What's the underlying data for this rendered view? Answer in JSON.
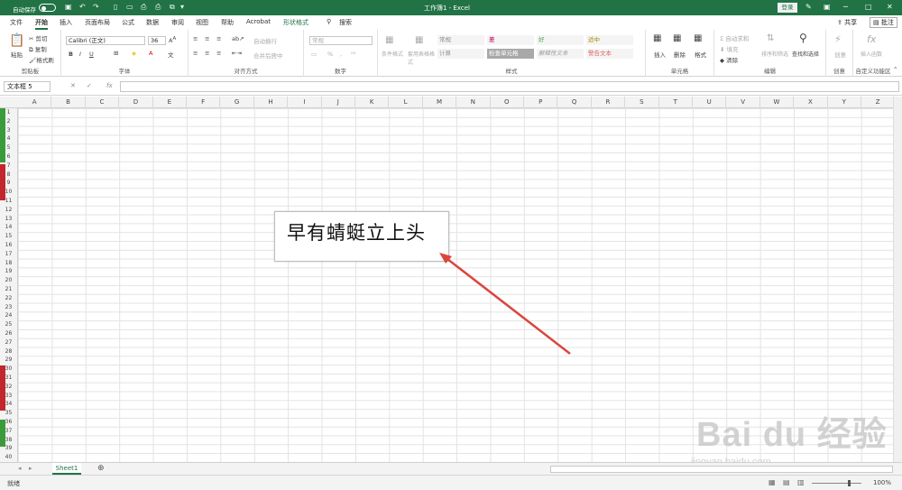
{
  "titlebar": {
    "autosave_label": "自动保存",
    "title": "工作簿1 - Excel",
    "login_label": "登录",
    "qat_icons": [
      "save-icon",
      "undo-icon",
      "redo-icon",
      "new-file-icon",
      "open-icon",
      "print-preview-icon",
      "print-icon",
      "copy-format-icon",
      "dropdown-icon"
    ],
    "window_buttons": [
      "pen-icon",
      "ribbon-display-icon",
      "minimize-icon",
      "maximize-icon",
      "close-icon"
    ]
  },
  "tabs": {
    "items": [
      "文件",
      "开始",
      "插入",
      "页面布局",
      "公式",
      "数据",
      "审阅",
      "视图",
      "帮助",
      "Acrobat",
      "形状格式",
      "搜索"
    ],
    "active": "开始",
    "share_label": "共享",
    "comment_label": "批注"
  },
  "ribbon": {
    "clipboard": {
      "label": "剪贴板",
      "paste": "粘贴",
      "cut": "剪切",
      "copy": "复制",
      "format_painter": "格式刷"
    },
    "font": {
      "label": "字体",
      "font_name": "Calibri (正文)",
      "font_size": "36",
      "bold": "B",
      "italic": "I",
      "underline": "U"
    },
    "alignment": {
      "label": "对齐方式",
      "wrap": "自动换行",
      "merge": "合并后居中"
    },
    "number": {
      "label": "数字",
      "format": "常规",
      "percent": "%"
    },
    "styles": {
      "label": "样式",
      "cond_format": "条件格式",
      "table_format": "套用表格格式",
      "cells": [
        "常规",
        "差",
        "好",
        "适中",
        "计算",
        "检查单元格",
        "解释性文本",
        "警告文本"
      ]
    },
    "cells": {
      "label": "单元格",
      "insert": "插入",
      "delete": "删除",
      "format": "格式"
    },
    "editing": {
      "label": "编辑",
      "autosum": "自动求和",
      "fill": "填充",
      "clear": "清除",
      "sort": "排序和筛选",
      "find": "查找和选择"
    },
    "create": {
      "label": "创意",
      "item": "创意"
    },
    "custom": {
      "label": "自定义功能区",
      "insert_func": "插入函数"
    }
  },
  "formula_bar": {
    "name_box": "文本框 5",
    "fx": "fx",
    "value": ""
  },
  "columns": [
    "A",
    "B",
    "C",
    "D",
    "E",
    "F",
    "G",
    "H",
    "I",
    "J",
    "K",
    "L",
    "M",
    "N",
    "O",
    "P",
    "Q",
    "R",
    "S",
    "T",
    "U",
    "V",
    "W",
    "X",
    "Y",
    "Z"
  ],
  "rows": [
    "1",
    "2",
    "3",
    "4",
    "5",
    "6",
    "7",
    "8",
    "9",
    "10",
    "11",
    "12",
    "13",
    "14",
    "15",
    "16",
    "17",
    "18",
    "19",
    "20",
    "21",
    "22",
    "23",
    "24",
    "25",
    "26",
    "27",
    "28",
    "29",
    "30",
    "31",
    "32",
    "33",
    "34",
    "35",
    "36",
    "37",
    "38",
    "39",
    "40"
  ],
  "textbox": {
    "text": "早有蜻蜓立上头"
  },
  "sheet_tabs": {
    "items": [
      "Sheet1"
    ],
    "active": "Sheet1"
  },
  "status": {
    "ready": "就绪",
    "zoom": "100%"
  },
  "annotation": {
    "arrow_color": "#d9463e"
  },
  "watermark": {
    "line1": "Bai du 经验",
    "line2": "jingyan.baidu.com"
  },
  "colors": {
    "brand": "#217346"
  }
}
